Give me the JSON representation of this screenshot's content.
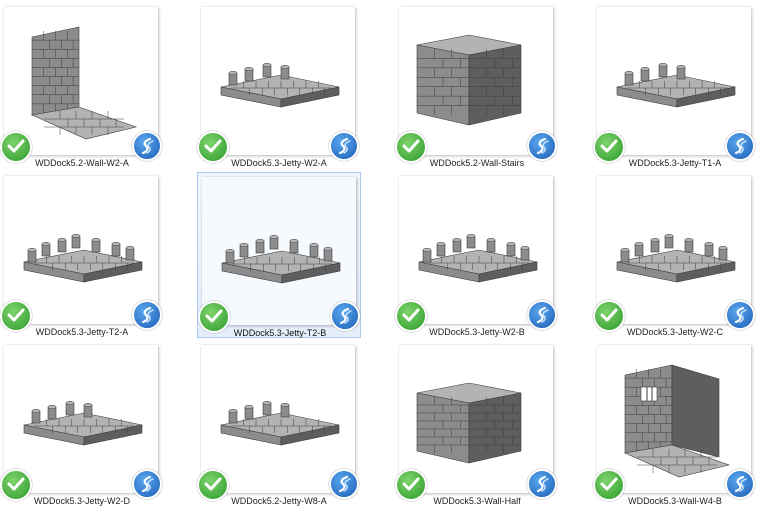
{
  "files": [
    {
      "name": "WDDock5.2-Wall-W2-A",
      "model": "wall-corner",
      "selected": false
    },
    {
      "name": "WDDock5.3-Jetty-W2-A",
      "model": "jetty-small",
      "selected": false
    },
    {
      "name": "WDDock5.2-Wall-Stairs",
      "model": "block-cube",
      "selected": false
    },
    {
      "name": "WDDock5.3-Jetty-T1-A",
      "model": "jetty-small",
      "selected": false
    },
    {
      "name": "WDDock5.3-Jetty-T2-A",
      "model": "jetty-large",
      "selected": false
    },
    {
      "name": "WDDock5.3-Jetty-T2-B",
      "model": "jetty-large",
      "selected": true
    },
    {
      "name": "WDDock5.3-Jetty-W2-B",
      "model": "jetty-large",
      "selected": false
    },
    {
      "name": "WDDock5.3-Jetty-W2-C",
      "model": "jetty-large",
      "selected": false
    },
    {
      "name": "WDDock5.3-Jetty-W2-D",
      "model": "jetty-diagonal",
      "selected": false
    },
    {
      "name": "WDDock5.2-Jetty-W8-A",
      "model": "jetty-small",
      "selected": false
    },
    {
      "name": "WDDock5.3-Wall-Half",
      "model": "block-half",
      "selected": false
    },
    {
      "name": "WDDock5.3-Wall-W4-B",
      "model": "wall-window",
      "selected": false
    }
  ],
  "icons": {
    "status": "green-checkmark-icon",
    "overlay": "blue-swirl-icon"
  },
  "colors": {
    "selection_fill": "#e4effb",
    "selection_border": "#a9cbef",
    "model_gray": "#8c8c8c",
    "check_green": "#2b9a2a",
    "badge_blue": "#1c5db5"
  }
}
